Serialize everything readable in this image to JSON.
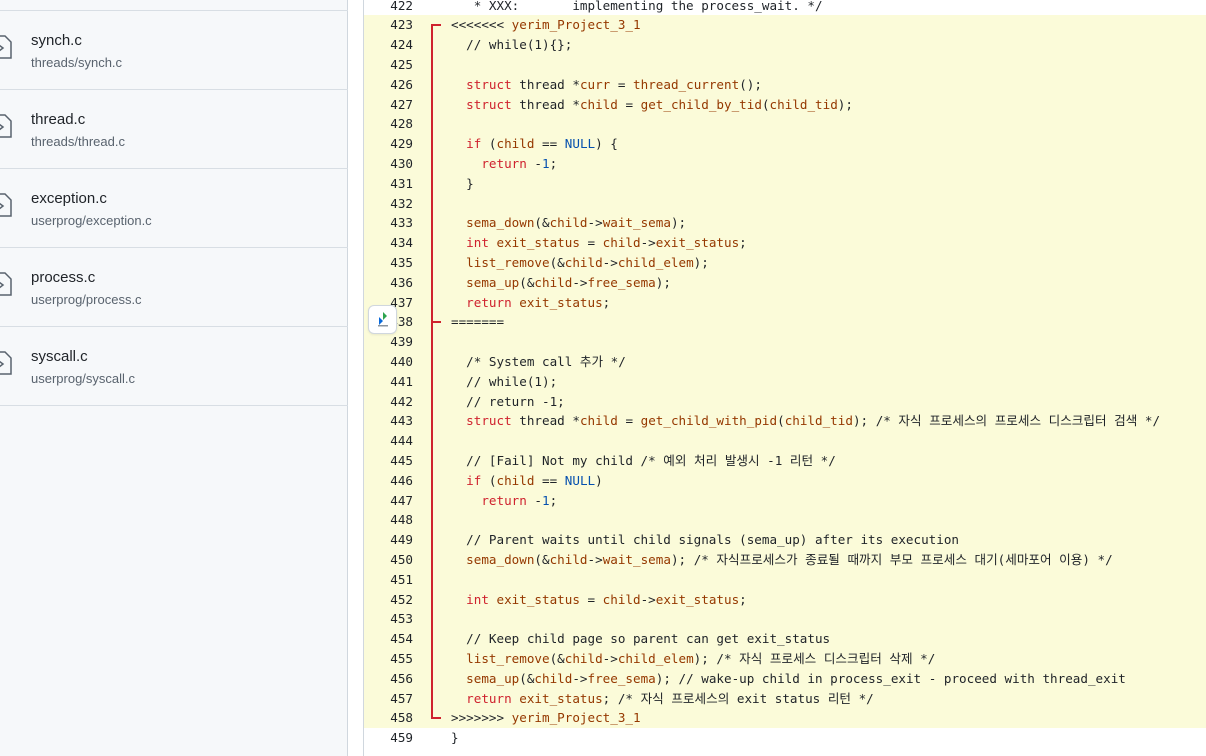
{
  "files": [
    {
      "name": "synch.c",
      "path": "threads/synch.c",
      "icon": "file-code-icon"
    },
    {
      "name": "thread.c",
      "path": "threads/thread.c",
      "icon": "file-code-icon"
    },
    {
      "name": "exception.c",
      "path": "userprog/exception.c",
      "icon": "file-code-icon"
    },
    {
      "name": "process.c",
      "path": "userprog/process.c",
      "icon": "file-code-icon"
    },
    {
      "name": "syscall.c",
      "path": "userprog/syscall.c",
      "icon": "file-code-icon"
    }
  ],
  "code": {
    "lines": [
      {
        "n": "422",
        "t": "   * XXX:       implementing the process_wait. */"
      },
      {
        "n": "423",
        "t": "<<<<<<< yerim_Project_3_1"
      },
      {
        "n": "424",
        "t": "  // while(1){};"
      },
      {
        "n": "425",
        "t": ""
      },
      {
        "n": "426",
        "t": "  struct thread *curr = thread_current();"
      },
      {
        "n": "427",
        "t": "  struct thread *child = get_child_by_tid(child_tid);"
      },
      {
        "n": "428",
        "t": ""
      },
      {
        "n": "429",
        "t": "  if (child == NULL) {"
      },
      {
        "n": "430",
        "t": "    return -1;"
      },
      {
        "n": "431",
        "t": "  }"
      },
      {
        "n": "432",
        "t": ""
      },
      {
        "n": "433",
        "t": "  sema_down(&child->wait_sema);"
      },
      {
        "n": "434",
        "t": "  int exit_status = child->exit_status;"
      },
      {
        "n": "435",
        "t": "  list_remove(&child->child_elem);"
      },
      {
        "n": "436",
        "t": "  sema_up(&child->free_sema);"
      },
      {
        "n": "437",
        "t": "  return exit_status;"
      },
      {
        "n": "438",
        "t": "======="
      },
      {
        "n": "439",
        "t": ""
      },
      {
        "n": "440",
        "t": "  /* System call 추가 */"
      },
      {
        "n": "441",
        "t": "  // while(1);"
      },
      {
        "n": "442",
        "t": "  // return -1;"
      },
      {
        "n": "443",
        "t": "  struct thread *child = get_child_with_pid(child_tid); /* 자식 프로세스의 프로세스 디스크립터 검색 */"
      },
      {
        "n": "444",
        "t": ""
      },
      {
        "n": "445",
        "t": "  // [Fail] Not my child /* 예외 처리 발생시 -1 리턴 */"
      },
      {
        "n": "446",
        "t": "  if (child == NULL)"
      },
      {
        "n": "447",
        "t": "    return -1;"
      },
      {
        "n": "448",
        "t": ""
      },
      {
        "n": "449",
        "t": "  // Parent waits until child signals (sema_up) after its execution"
      },
      {
        "n": "450",
        "t": "  sema_down(&child->wait_sema); /* 자식프로세스가 종료될 때까지 부모 프로세스 대기(세마포어 이용) */"
      },
      {
        "n": "451",
        "t": ""
      },
      {
        "n": "452",
        "t": "  int exit_status = child->exit_status;"
      },
      {
        "n": "453",
        "t": ""
      },
      {
        "n": "454",
        "t": "  // Keep child page so parent can get exit_status"
      },
      {
        "n": "455",
        "t": "  list_remove(&child->child_elem); /* 자식 프로세스 디스크립터 삭제 */"
      },
      {
        "n": "456",
        "t": "  sema_up(&child->free_sema); // wake-up child in process_exit - proceed with thread_exit"
      },
      {
        "n": "457",
        "t": "  return exit_status; /* 자식 프로세스의 exit status 리턴 */"
      },
      {
        "n": "458",
        "t": ">>>>>>> yerim_Project_3_1"
      },
      {
        "n": "459",
        "t": "}"
      }
    ]
  },
  "colors": {
    "conflict_bg": "#fbfbd9",
    "conflict_marker": "#cf222e",
    "keyword": "#cf222e",
    "identifier": "#953800",
    "constant": "#0550ae"
  },
  "icons": {
    "avatar": "avatar-icon"
  }
}
